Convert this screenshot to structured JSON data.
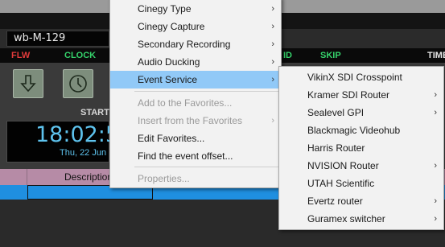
{
  "app": {
    "device_name": "wb-M-129",
    "status": {
      "flw": "FLW",
      "clock": "CLOCK",
      "id": "ID",
      "skip": "SKIP",
      "time": "TIME"
    },
    "start_label": "START",
    "clock_time": "18:02:5",
    "clock_date": "Thu, 22 Jun",
    "table": {
      "description_header": "Description"
    },
    "colors": {
      "status_red": "#e23b3b",
      "status_green": "#35d26b",
      "clock_blue": "#5ec3ee",
      "table_header": "#b68ba6",
      "selected_row": "#1f8fe0"
    }
  },
  "context_menu": {
    "items": [
      {
        "label": "Cinegy Type",
        "submenu": true,
        "disabled": false
      },
      {
        "label": "Cinegy Capture",
        "submenu": true,
        "disabled": false
      },
      {
        "label": "Secondary Recording",
        "submenu": true,
        "disabled": false
      },
      {
        "label": "Audio Ducking",
        "submenu": true,
        "disabled": false
      },
      {
        "label": "Event Service",
        "submenu": true,
        "disabled": false,
        "highlighted": true
      },
      {
        "label": "Add to the Favorites...",
        "submenu": false,
        "disabled": true
      },
      {
        "label": "Insert from the Favorites",
        "submenu": true,
        "disabled": true
      },
      {
        "label": "Edit Favorites...",
        "submenu": false,
        "disabled": false
      },
      {
        "label": "Find the event offset...",
        "submenu": false,
        "disabled": false
      },
      {
        "label": "Properties...",
        "submenu": false,
        "disabled": true
      }
    ],
    "arrow": "›"
  },
  "event_service_menu": {
    "items": [
      {
        "label": "VikinX SDI Crosspoint",
        "submenu": false
      },
      {
        "label": "Kramer SDI Router",
        "submenu": true
      },
      {
        "label": "Sealevel GPI",
        "submenu": true
      },
      {
        "label": "Blackmagic Videohub",
        "submenu": false
      },
      {
        "label": "Harris Router",
        "submenu": false
      },
      {
        "label": "NVISION Router",
        "submenu": true
      },
      {
        "label": "UTAH Scientific",
        "submenu": false
      },
      {
        "label": "Evertz router",
        "submenu": true
      },
      {
        "label": "Guramex switcher",
        "submenu": true
      }
    ],
    "arrow": "›"
  }
}
